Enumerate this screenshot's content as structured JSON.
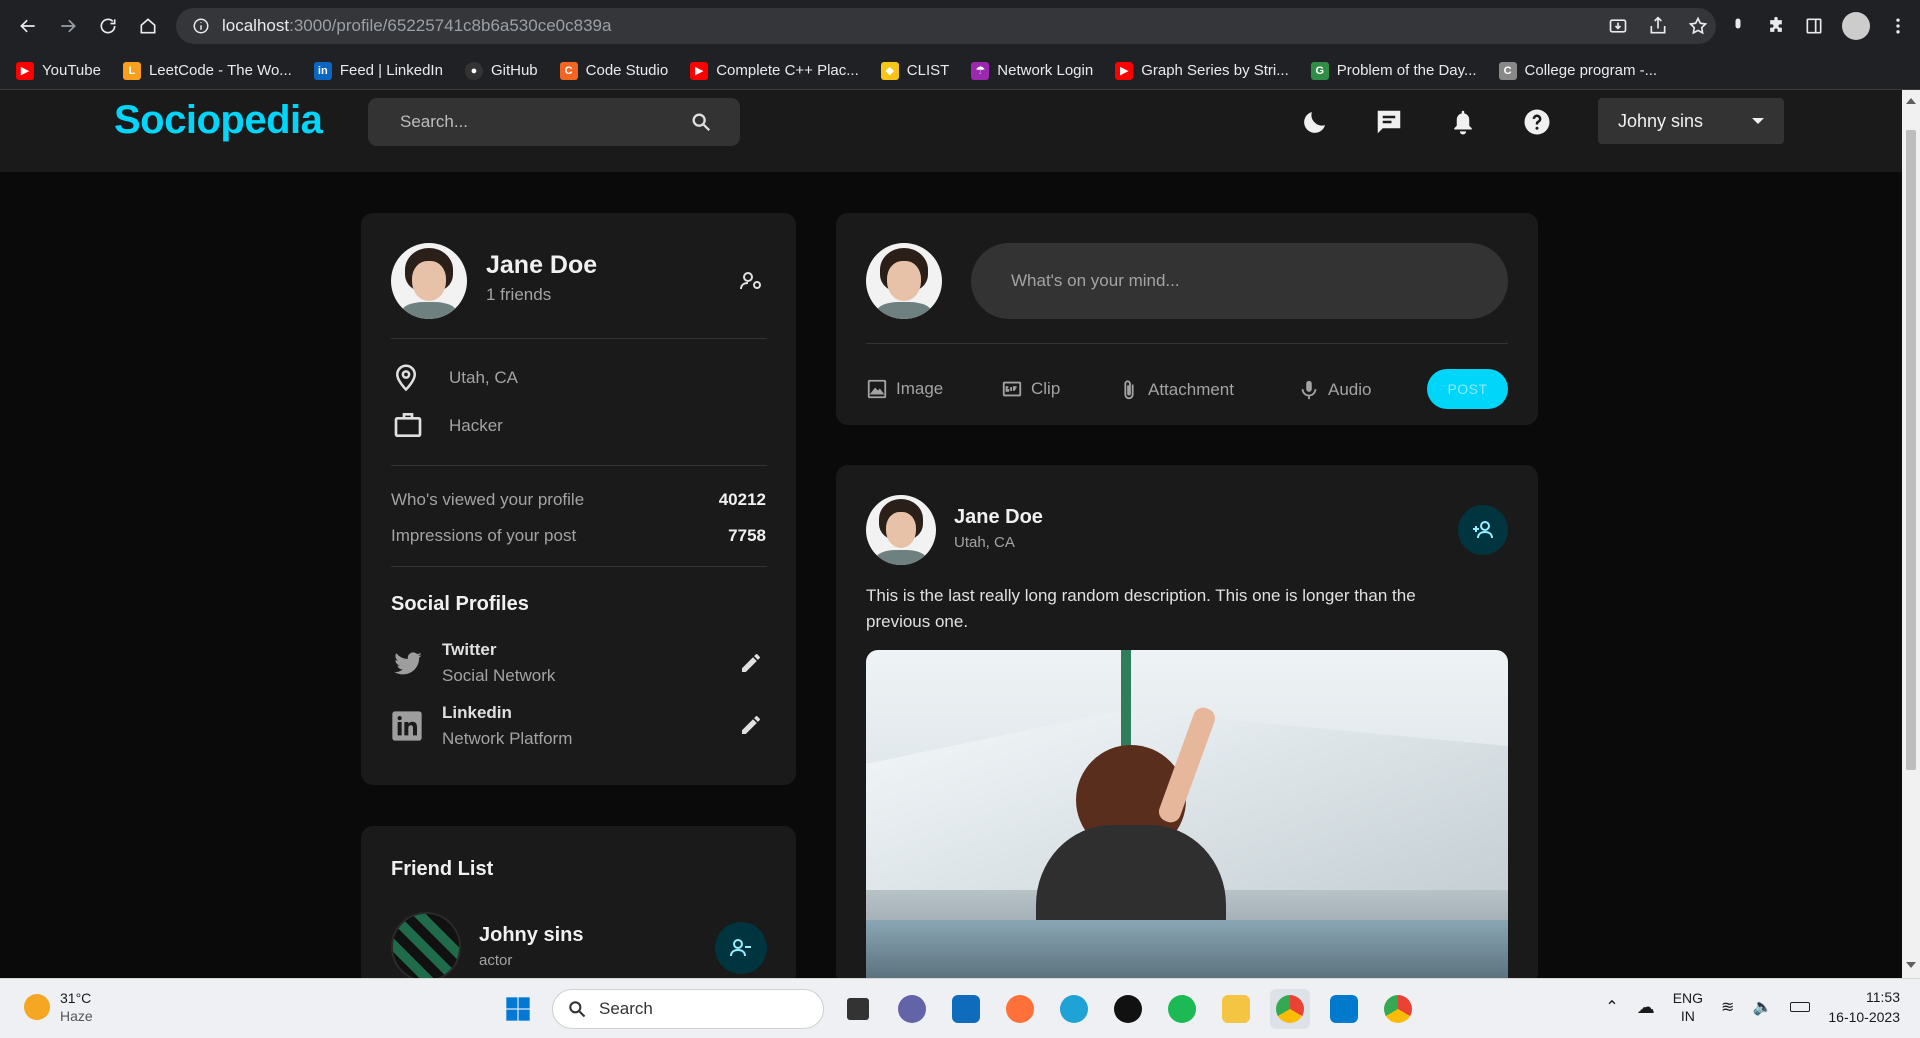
{
  "browser": {
    "url_host": "localhost",
    "url_path": ":3000/profile/65225741c8b6a530ce0c839a",
    "bookmarks": [
      {
        "label": "YouTube",
        "color": "#ff0000"
      },
      {
        "label": "LeetCode - The Wo...",
        "color": "#f89f1b"
      },
      {
        "label": "Feed | LinkedIn",
        "color": "#0a66c2"
      },
      {
        "label": "GitHub",
        "color": "#333333"
      },
      {
        "label": "Code Studio",
        "color": "#f26522"
      },
      {
        "label": "Complete C++ Plac...",
        "color": "#ff0000"
      },
      {
        "label": "CLIST",
        "color": "#f5c518"
      },
      {
        "label": "Network Login",
        "color": "#9c27b0"
      },
      {
        "label": "Graph Series by Stri...",
        "color": "#ff0000"
      },
      {
        "label": "Problem of the Day...",
        "color": "#2f8d46"
      },
      {
        "label": "College program -...",
        "color": "#888888"
      }
    ]
  },
  "app": {
    "logo": "Sociopedia",
    "search_placeholder": "Search...",
    "user_menu": "Johny sins",
    "colors": {
      "accent": "#00d5fa",
      "card": "#1a1a1a",
      "background": "#0a0a0a"
    }
  },
  "profile": {
    "name": "Jane Doe",
    "friends": "1 friends",
    "location": "Utah, CA",
    "occupation": "Hacker",
    "viewed_label": "Who's viewed your profile",
    "viewed_value": "40212",
    "impressions_label": "Impressions of your post",
    "impressions_value": "7758",
    "social_title": "Social Profiles",
    "socials": [
      {
        "name": "Twitter",
        "sub": "Social Network"
      },
      {
        "name": "Linkedin",
        "sub": "Network Platform"
      }
    ]
  },
  "friend_list": {
    "title": "Friend List",
    "friends": [
      {
        "name": "Johny sins",
        "sub": "actor"
      }
    ]
  },
  "composer": {
    "placeholder": "What's on your mind...",
    "actions": [
      "Image",
      "Clip",
      "Attachment",
      "Audio"
    ],
    "post_label": "POST"
  },
  "post": {
    "author": "Jane Doe",
    "location": "Utah, CA",
    "description": "This is the last really long random description. This one is longer than the previous one."
  },
  "taskbar": {
    "temp": "31°C",
    "weather": "Haze",
    "search_label": "Search",
    "lang": "ENG",
    "region": "IN",
    "time": "11:53",
    "date": "16-10-2023"
  }
}
